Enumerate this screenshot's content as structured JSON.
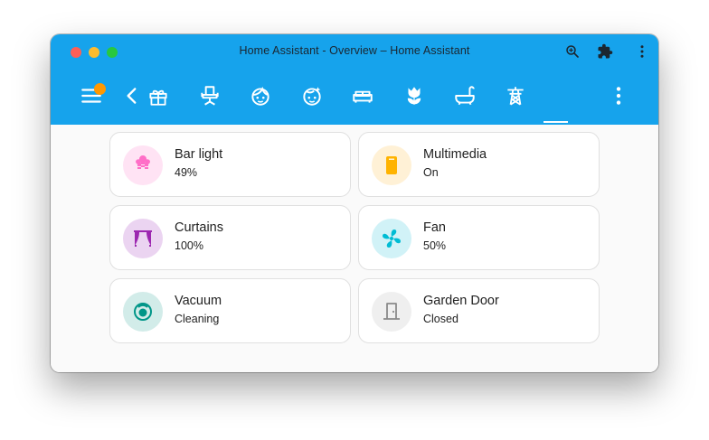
{
  "window": {
    "title": "Home Assistant - Overview – Home Assistant"
  },
  "toolbar": {
    "views": [
      {
        "icon": "gift-icon"
      },
      {
        "icon": "office-chair-icon"
      },
      {
        "icon": "face-woman-icon"
      },
      {
        "icon": "face-man-icon"
      },
      {
        "icon": "sofa-icon"
      },
      {
        "icon": "flower-tulip-icon"
      },
      {
        "icon": "bathtub-icon"
      },
      {
        "icon": "transmission-tower-icon",
        "active": true
      }
    ]
  },
  "cards": [
    {
      "name": "Bar light",
      "state": "49%",
      "icon": "lightbulb-group-icon",
      "icon_color": "#ff6ec7",
      "bg_color": "#ffe3f4"
    },
    {
      "name": "Multimedia",
      "state": "On",
      "icon": "speaker-icon",
      "icon_color": "#ffb300",
      "bg_color": "#fff1d6"
    },
    {
      "name": "Curtains",
      "state": "100%",
      "icon": "curtains-icon",
      "icon_color": "#9c27b0",
      "bg_color": "#ebd4f1"
    },
    {
      "name": "Fan",
      "state": "50%",
      "icon": "fan-icon",
      "icon_color": "#00bcd4",
      "bg_color": "#d1f2f7"
    },
    {
      "name": "Vacuum",
      "state": "Cleaning",
      "icon": "robot-vacuum-icon",
      "icon_color": "#009688",
      "bg_color": "#d2ece9"
    },
    {
      "name": "Garden Door",
      "state": "Closed",
      "icon": "door-icon",
      "icon_color": "#8a8a8a",
      "bg_color": "#efefef"
    }
  ],
  "colors": {
    "header": "#16a3ec",
    "notification_badge": "#ff9800"
  }
}
